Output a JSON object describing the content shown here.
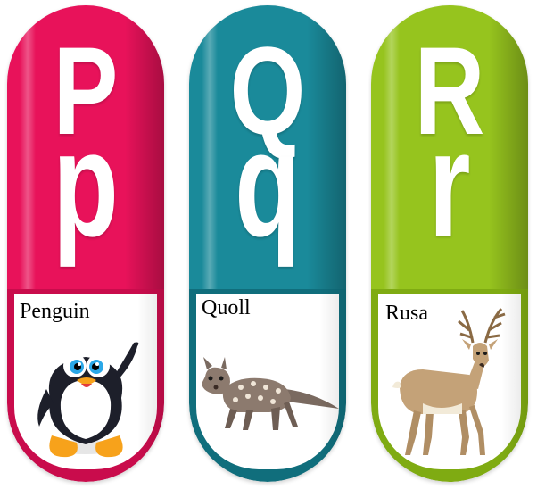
{
  "cards": [
    {
      "upper": "P",
      "lower": "p",
      "animal": "Penguin",
      "color": "#e8125a",
      "bottom_color": "#c90c4c",
      "art": "penguin-icon"
    },
    {
      "upper": "Q",
      "lower": "q",
      "animal": "Quoll",
      "color": "#1a8a9a",
      "bottom_color": "#106e7c",
      "art": "quoll-icon"
    },
    {
      "upper": "R",
      "lower": "r",
      "animal": "Rusa",
      "color": "#96c41e",
      "bottom_color": "#7fab12",
      "art": "deer-icon"
    }
  ]
}
